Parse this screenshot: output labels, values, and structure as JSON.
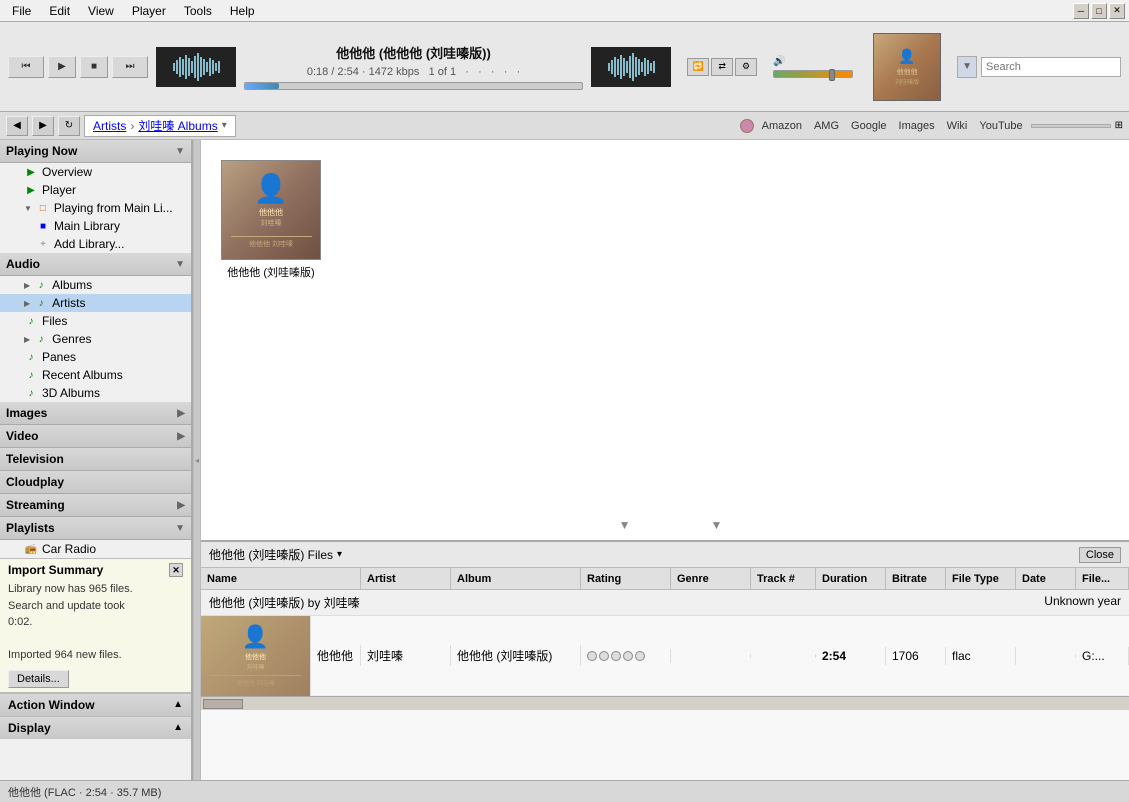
{
  "menu": {
    "items": [
      "File",
      "Edit",
      "View",
      "Player",
      "Tools",
      "Help"
    ]
  },
  "window": {
    "minimize": "─",
    "maximize": "□",
    "close": "✕"
  },
  "transport": {
    "track_title": "他他他 (他他他 (刘哇嗪版))",
    "time_current": "0:18",
    "time_total": "2:54",
    "bitrate": "1472 kbps",
    "position": "1 of 1",
    "progress_percent": 10,
    "volume_percent": 70,
    "search_placeholder": "Search",
    "buttons": {
      "prev": "⏮",
      "play": "▶",
      "stop": "■",
      "next": "⏭",
      "repeat": "🔁",
      "shuffle": "⇄",
      "settings": "⚙"
    }
  },
  "navbar": {
    "back": "◀",
    "forward": "▶",
    "refresh": "↻",
    "breadcrumb": [
      "Artists",
      "刘哇嗪 Albums"
    ],
    "links": [
      "Amazon",
      "AMG",
      "Google",
      "Images",
      "Wiki",
      "YouTube"
    ],
    "dropdown_arrow": "▾"
  },
  "sidebar": {
    "sections": [
      {
        "id": "playing_now",
        "label": "Playing Now",
        "expanded": true,
        "items": [
          {
            "id": "overview",
            "label": "Overview",
            "indent": 1,
            "icon": "▶",
            "icon_color": "green"
          },
          {
            "id": "player",
            "label": "Player",
            "indent": 1,
            "icon": "▶",
            "icon_color": "green"
          },
          {
            "id": "playing_from",
            "label": "Playing from Main Li...",
            "indent": 1,
            "icon": "□",
            "icon_color": "orange",
            "expanded": true
          },
          {
            "id": "main_library",
            "label": "Main Library",
            "indent": 2,
            "icon": "■",
            "icon_color": "blue"
          },
          {
            "id": "add_library",
            "label": "Add Library...",
            "indent": 2,
            "icon": "+",
            "icon_color": "gray"
          }
        ]
      },
      {
        "id": "audio",
        "label": "Audio",
        "expanded": true,
        "items": [
          {
            "id": "albums",
            "label": "Albums",
            "indent": 1,
            "icon": "♪",
            "icon_color": "green"
          },
          {
            "id": "artists",
            "label": "Artists",
            "indent": 1,
            "icon": "♪",
            "icon_color": "green",
            "active": true
          },
          {
            "id": "files",
            "label": "Files",
            "indent": 1,
            "icon": "♪",
            "icon_color": "green"
          },
          {
            "id": "genres",
            "label": "Genres",
            "indent": 1,
            "icon": "♪",
            "icon_color": "green"
          },
          {
            "id": "panes",
            "label": "Panes",
            "indent": 1,
            "icon": "♪",
            "icon_color": "green"
          },
          {
            "id": "recent_albums",
            "label": "Recent Albums",
            "indent": 1,
            "icon": "♪",
            "icon_color": "green"
          },
          {
            "id": "3d_albums",
            "label": "3D Albums",
            "indent": 1,
            "icon": "♪",
            "icon_color": "green"
          }
        ]
      },
      {
        "id": "images",
        "label": "Images",
        "arrow": "▶"
      },
      {
        "id": "video",
        "label": "Video",
        "arrow": "▶"
      },
      {
        "id": "television",
        "label": "Television"
      },
      {
        "id": "cloudplay",
        "label": "Cloudplay"
      },
      {
        "id": "streaming",
        "label": "Streaming",
        "arrow": "▶"
      },
      {
        "id": "playlists",
        "label": "Playlists",
        "arrow": "▶",
        "items": [
          {
            "id": "car_radio",
            "label": "Car Radio",
            "icon": "📻"
          }
        ]
      }
    ],
    "import_summary": {
      "title": "Import Summary",
      "lines": [
        "Library now has 965 files.",
        "Search and update took",
        "0:02.",
        "",
        "Imported 964 new files."
      ],
      "details_btn": "Details..."
    },
    "action_window": "Action Window",
    "display": "Display"
  },
  "album_grid": {
    "album": {
      "title": "他他他 (刘哇嗪版)",
      "image_text": "他他他\n刘哇嗪"
    }
  },
  "file_panel": {
    "title": "他他他 (刘哇嗪版) Files",
    "close_btn": "Close",
    "columns": [
      "Name",
      "Artist",
      "Album",
      "Rating",
      "Genre",
      "Track #",
      "Duration",
      "Bitrate",
      "File Type",
      "Date",
      "File..."
    ],
    "album_section": {
      "left": "他他他 (刘哇嗪版) by 刘哇嗪",
      "right": "Unknown year"
    },
    "tracks": [
      {
        "name": "他他他",
        "artist": "刘哇嗪",
        "album": "他他他 (刘哇嗪版)",
        "rating": [
          0,
          0,
          0,
          0,
          0
        ],
        "genre": "",
        "track": "",
        "duration": "2:54",
        "bitrate": "1706",
        "filetype": "flac",
        "date": "",
        "filepath": "G:..."
      }
    ]
  },
  "status_bar": {
    "text": "他他他 (FLAC · 2:54 · 35.7 MB)"
  }
}
